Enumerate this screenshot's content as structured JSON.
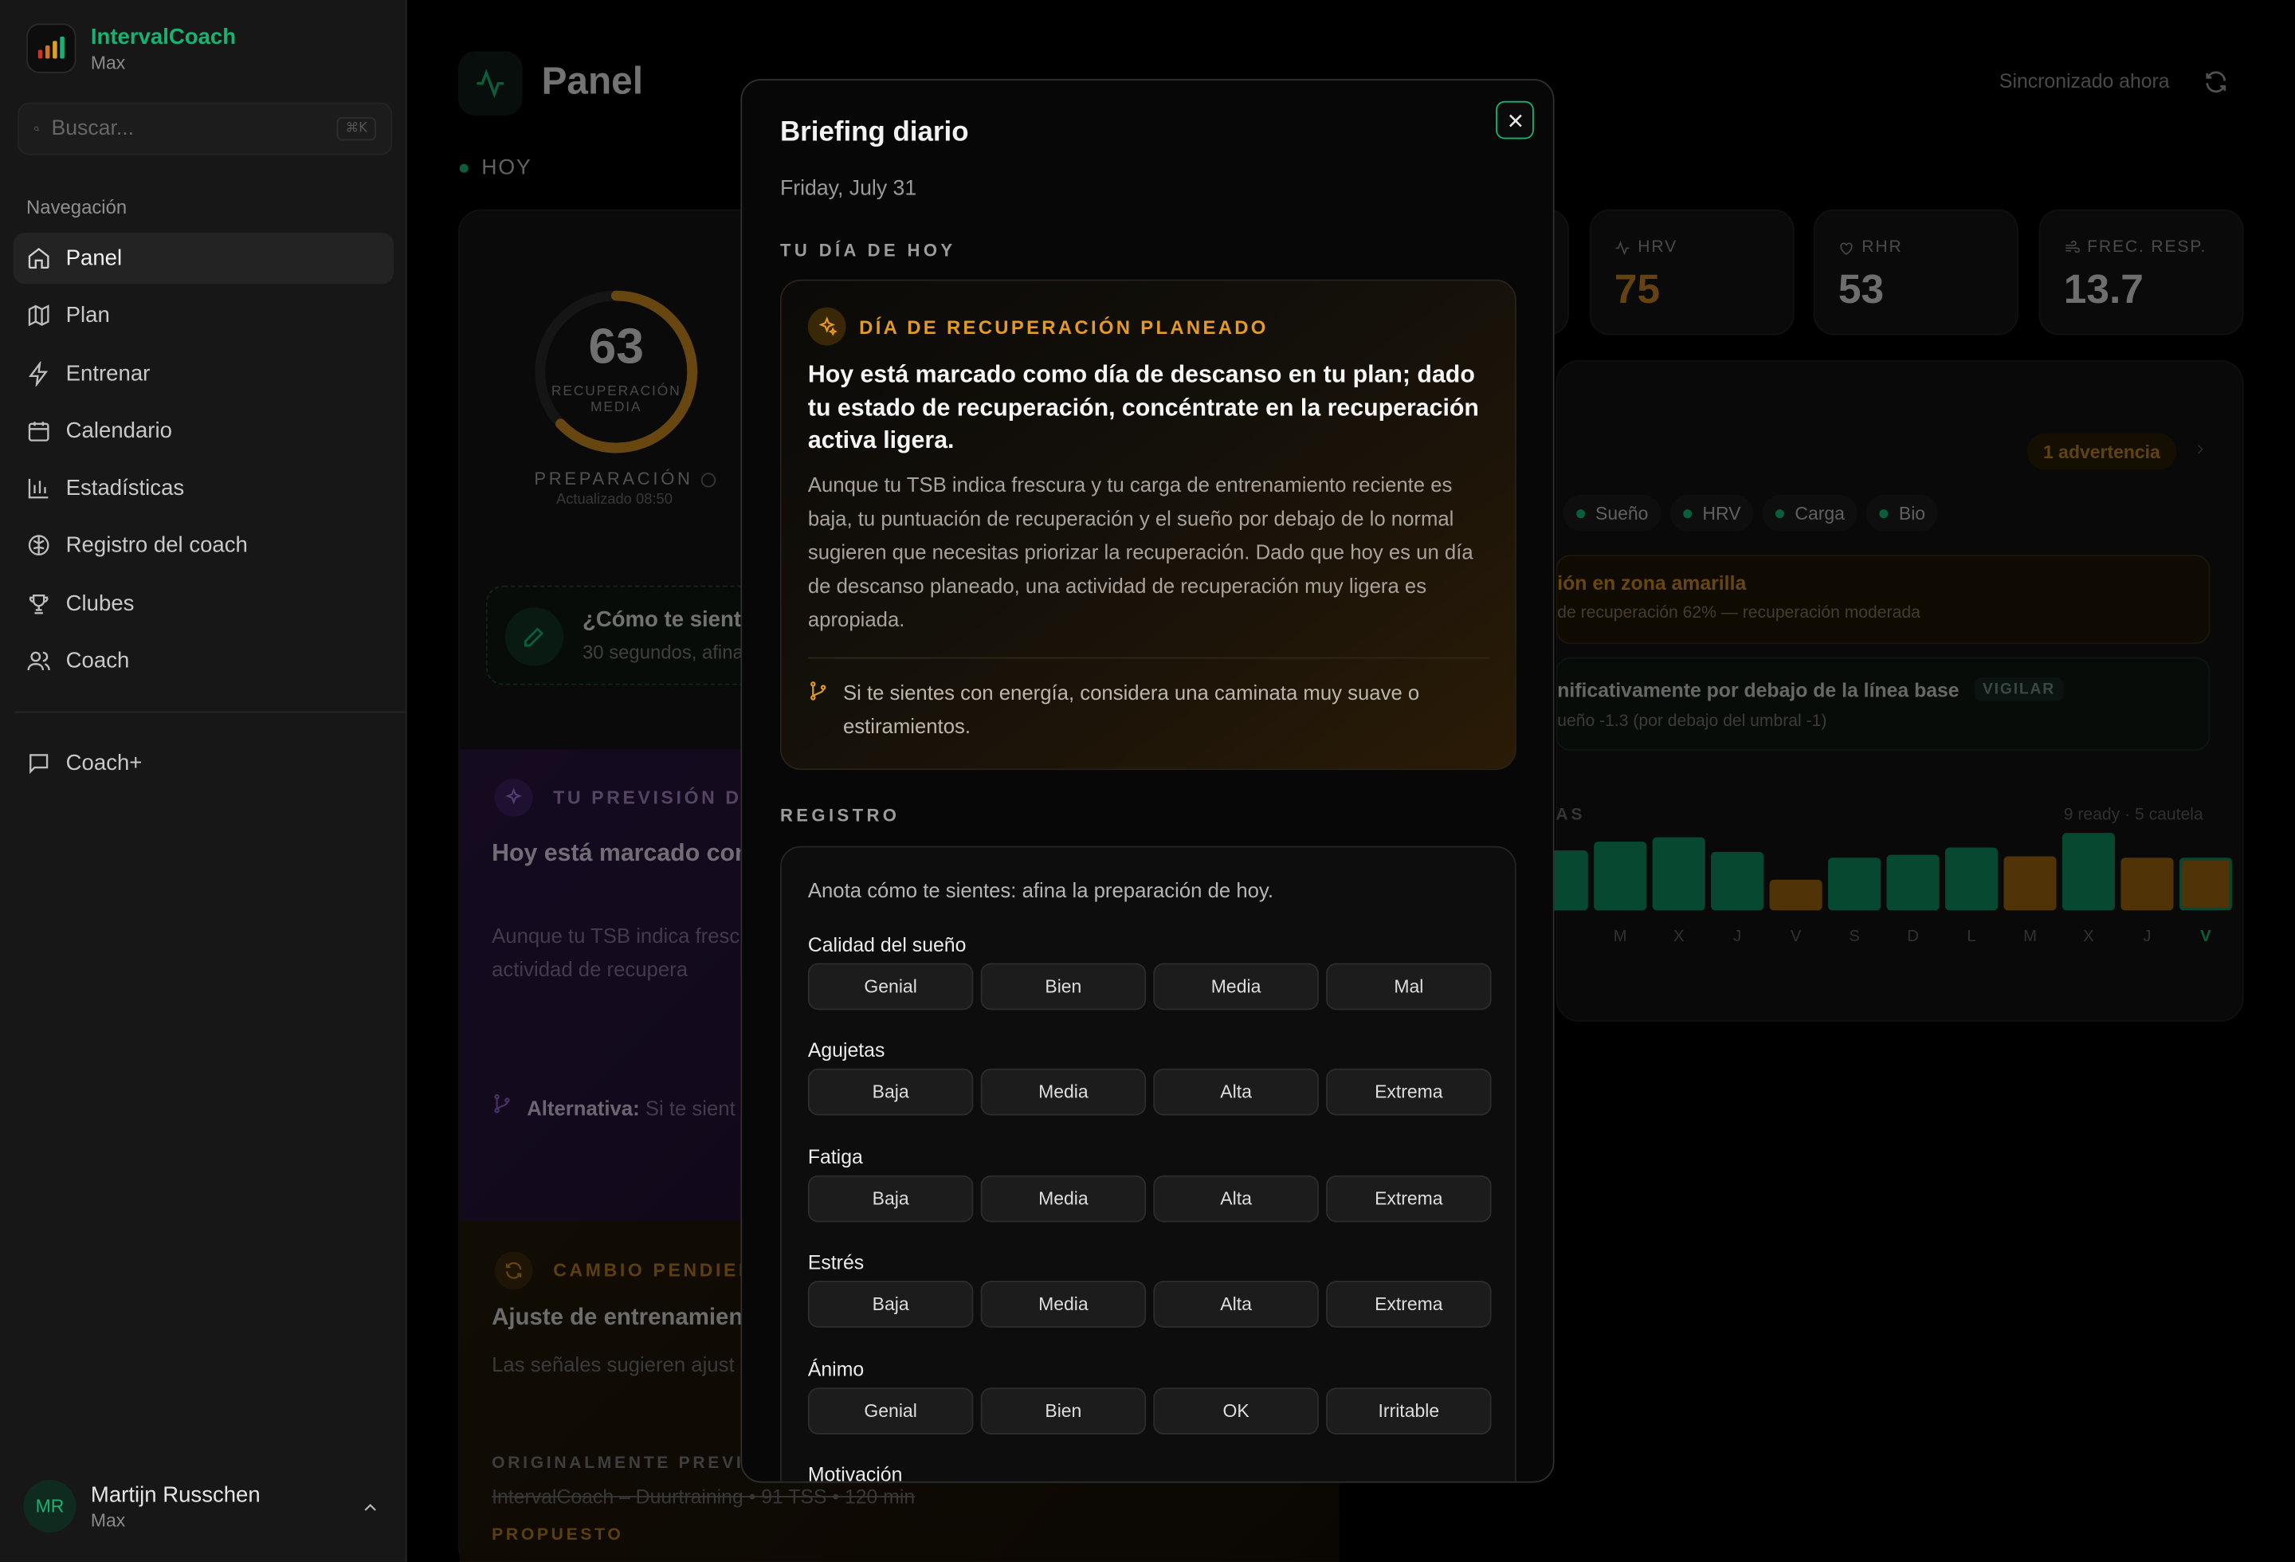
{
  "sidebar": {
    "brand": {
      "name": "IntervalCoach",
      "sub": "Max"
    },
    "search": {
      "placeholder": "Buscar...",
      "shortcut": "⌘K"
    },
    "nav_label": "Navegación",
    "items": [
      {
        "label": "Panel",
        "icon": "home-icon"
      },
      {
        "label": "Plan",
        "icon": "map-icon"
      },
      {
        "label": "Entrenar",
        "icon": "bolt-icon"
      },
      {
        "label": "Calendario",
        "icon": "calendar-icon"
      },
      {
        "label": "Estadísticas",
        "icon": "bar-chart-icon"
      },
      {
        "label": "Registro del coach",
        "icon": "brain-icon"
      },
      {
        "label": "Clubes",
        "icon": "trophy-icon"
      },
      {
        "label": "Coach",
        "icon": "users-icon"
      }
    ],
    "coach_plus": "Coach+",
    "user": {
      "initials": "MR",
      "name": "Martijn Russchen",
      "plan": "Max"
    }
  },
  "header": {
    "title": "Panel",
    "sync_status": "Sincronizado ahora",
    "today_label": "HOY"
  },
  "readiness": {
    "value": 63,
    "ring_label": "RECUPERACIÓN MEDIA",
    "ring_fraction": 0.63,
    "title": "PREPARACIÓN",
    "updated": "Actualizado 08:50"
  },
  "feel_prompt": {
    "title": "¿Cómo te sientes",
    "sub": "30 segundos, afina"
  },
  "forecast": {
    "tag": "TU PREVISIÓN DIA",
    "headline": "Hoy está marcado com recuperación, concént",
    "body": "Aunque tu TSB indica fresc puntuación de recuperació necesitas priorizar la recup una actividad de recupera",
    "alt_label": "Alternativa:",
    "alt_text": " Si te sient estiramientos."
  },
  "pending": {
    "tag": "CAMBIO PENDIEN",
    "headline": "Ajuste de entrenamient",
    "body": "Las señales sugieren ajust mantén el original.",
    "original_label": "ORIGINALMENTE PREVIST",
    "original_session": "IntervalCoach – Duurtraining  •  91 TSS  •  120 min",
    "proposed_label": "PROPUESTO"
  },
  "metrics": [
    {
      "label": "HRV",
      "value": "75",
      "color": "#c17f1e",
      "icon": "pulse-icon"
    },
    {
      "label": "RHR",
      "value": "53",
      "color": "#d4d4d4",
      "icon": "heart-icon"
    },
    {
      "label": "FREC. RESP.",
      "value": "13.7",
      "color": "#d4d4d4",
      "icon": "wind-icon"
    }
  ],
  "insights": {
    "warning_pill": "1 advertencia",
    "chips": [
      "Sueño",
      "HRV",
      "Carga",
      "Bio"
    ],
    "alert1": {
      "title": "ión en zona amarilla",
      "detail": "de recuperación 62% — recuperación moderada"
    },
    "alert2": {
      "title": "nificativamente por debajo de la línea base",
      "tag": "VIGILAR",
      "detail": "ueño -1.3 (por debajo del umbral -1)"
    },
    "days_label": "AS",
    "days_stat": "9 ready · 5 cautela"
  },
  "chart_data": {
    "type": "bar",
    "categories": [
      "",
      "M",
      "X",
      "J",
      "V",
      "S",
      "D",
      "L",
      "M",
      "X",
      "J",
      "V"
    ],
    "status": [
      "ready",
      "ready",
      "ready",
      "ready",
      "cautela",
      "ready",
      "ready",
      "ready",
      "cautela",
      "ready",
      "cautela",
      "cautela"
    ],
    "values": [
      33,
      38,
      40,
      32,
      17,
      29,
      31,
      35,
      30,
      43,
      29,
      29
    ],
    "ylim": [
      0,
      50
    ],
    "colors": {
      "ready": "#0f8a5c",
      "cautela": "#9a620f"
    }
  },
  "modal": {
    "title": "Briefing diario",
    "date": "Friday, July 31",
    "section_today": "TU DÍA DE HOY",
    "recovery": {
      "tag": "DÍA DE RECUPERACIÓN PLANEADO",
      "headline": "Hoy está marcado como día de descanso en tu plan; dado tu estado de recuperación, concéntrate en la recuperación activa ligera.",
      "body": "Aunque tu TSB indica frescura y tu carga de entrenamiento reciente es baja, tu puntuación de recuperación y el sueño por debajo de lo normal sugieren que necesitas priorizar la recuperación. Dado que hoy es un día de descanso planeado, una actividad de recuperación muy ligera es apropiada.",
      "alternative": "Si te sientes con energía, considera una caminata muy suave o estiramientos."
    },
    "section_log": "REGISTRO",
    "log_intro": "Anota cómo te sientes: afina la preparación de hoy.",
    "questions": [
      {
        "label": "Calidad del sueño",
        "options": [
          "Genial",
          "Bien",
          "Media",
          "Mal"
        ]
      },
      {
        "label": "Agujetas",
        "options": [
          "Baja",
          "Media",
          "Alta",
          "Extrema"
        ]
      },
      {
        "label": "Fatiga",
        "options": [
          "Baja",
          "Media",
          "Alta",
          "Extrema"
        ]
      },
      {
        "label": "Estrés",
        "options": [
          "Baja",
          "Media",
          "Alta",
          "Extrema"
        ]
      },
      {
        "label": "Ánimo",
        "options": [
          "Genial",
          "Bien",
          "OK",
          "Irritable"
        ]
      },
      {
        "label": "Motivación",
        "options": []
      }
    ]
  },
  "colors": {
    "accent": "#16b372",
    "warning": "#e39a26",
    "purple": "#8a5cc7"
  }
}
